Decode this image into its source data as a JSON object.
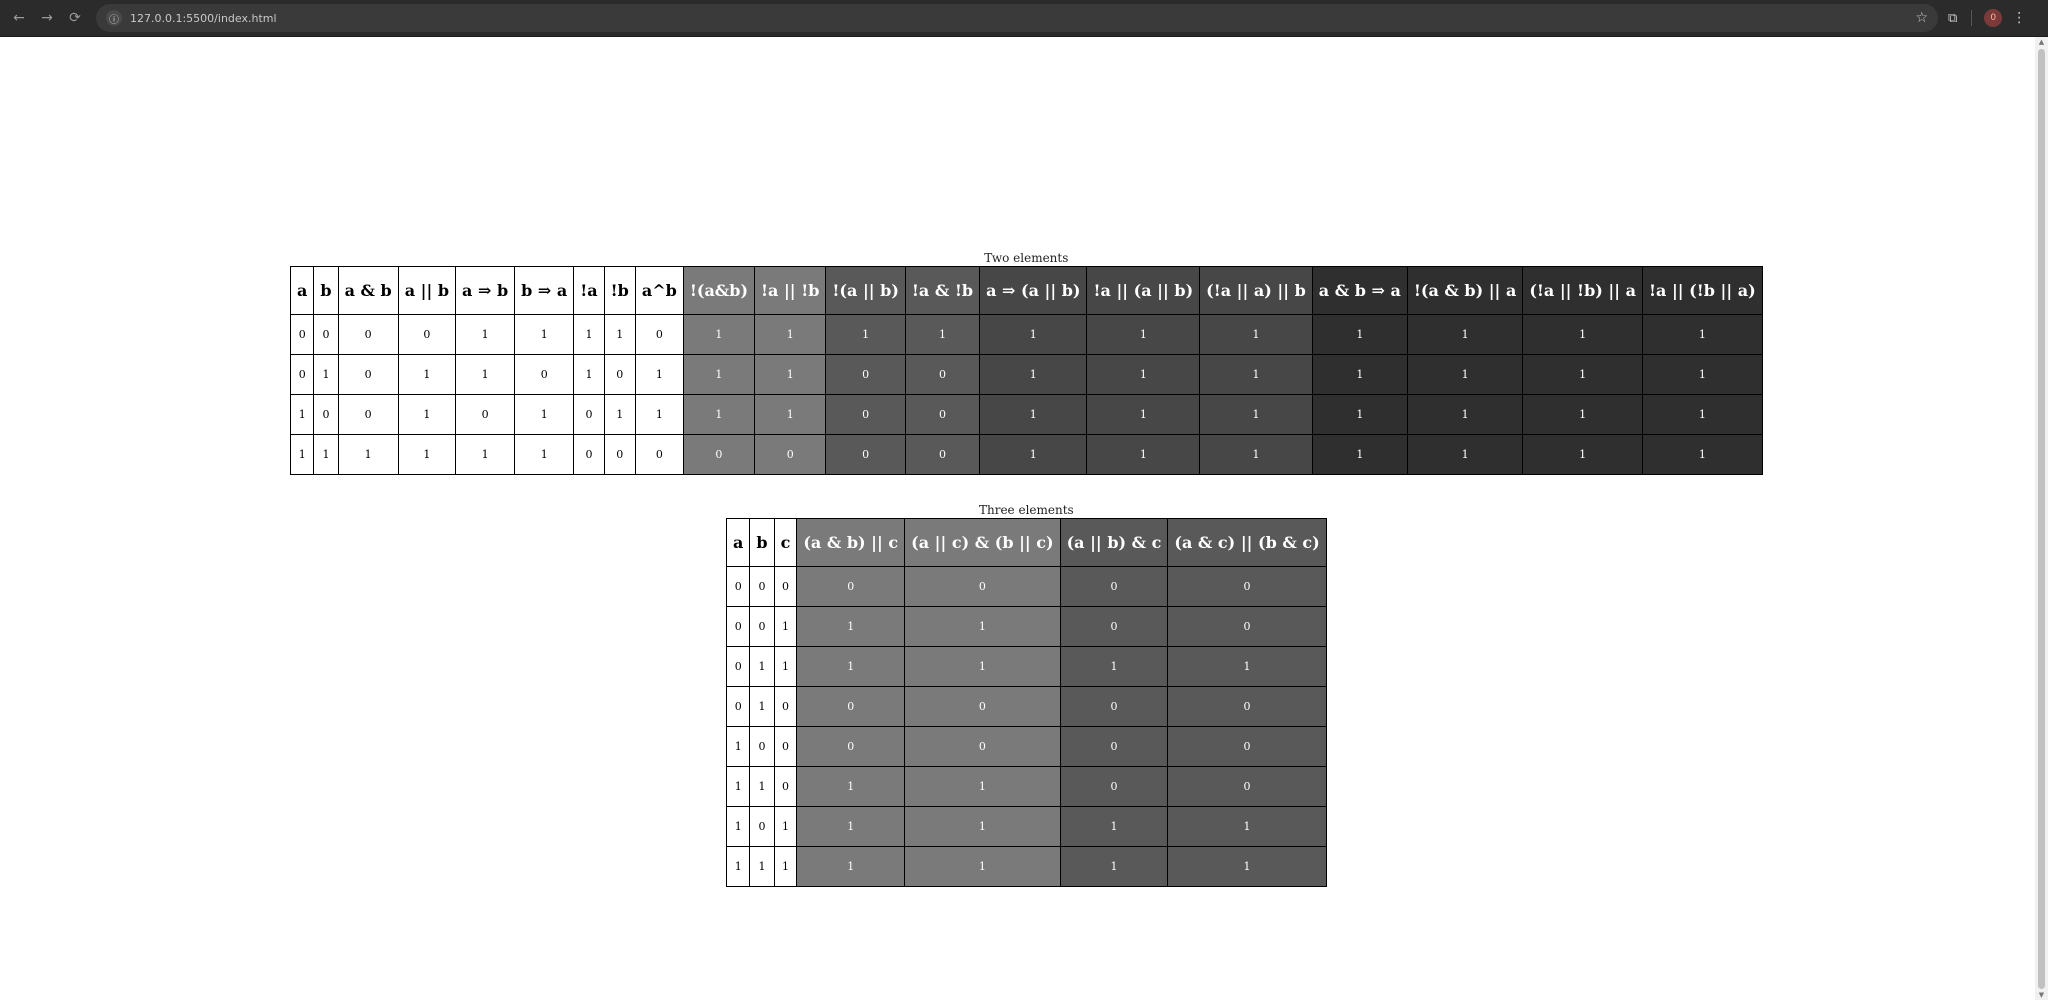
{
  "browser": {
    "url": "127.0.0.1:5500/index.html",
    "profile_initial": "0"
  },
  "tables": [
    {
      "caption": "Two elements",
      "headers": [
        {
          "label": "a",
          "shade": 0
        },
        {
          "label": "b",
          "shade": 0
        },
        {
          "label": "a & b",
          "shade": 0
        },
        {
          "label": "a || b",
          "shade": 0
        },
        {
          "label": "a ⇒ b",
          "shade": 0
        },
        {
          "label": "b ⇒ a",
          "shade": 0
        },
        {
          "label": "!a",
          "shade": 0
        },
        {
          "label": "!b",
          "shade": 0
        },
        {
          "label": "a^b",
          "shade": 0
        },
        {
          "label": "!(a&b)",
          "shade": 1
        },
        {
          "label": "!a || !b",
          "shade": 1
        },
        {
          "label": "!(a || b)",
          "shade": 2
        },
        {
          "label": "!a & !b",
          "shade": 2
        },
        {
          "label": "a ⇒ (a || b)",
          "shade": 3
        },
        {
          "label": "!a || (a || b)",
          "shade": 3
        },
        {
          "label": "(!a || a) || b",
          "shade": 3
        },
        {
          "label": "a & b ⇒ a",
          "shade": 4
        },
        {
          "label": "!(a & b) || a",
          "shade": 4
        },
        {
          "label": "(!a || !b) || a",
          "shade": 4
        },
        {
          "label": "!a || (!b || a)",
          "shade": 4
        }
      ],
      "rows": [
        [
          "0",
          "0",
          "0",
          "0",
          "1",
          "1",
          "1",
          "1",
          "0",
          "1",
          "1",
          "1",
          "1",
          "1",
          "1",
          "1",
          "1",
          "1",
          "1",
          "1"
        ],
        [
          "0",
          "1",
          "0",
          "1",
          "1",
          "0",
          "1",
          "0",
          "1",
          "1",
          "1",
          "0",
          "0",
          "1",
          "1",
          "1",
          "1",
          "1",
          "1",
          "1"
        ],
        [
          "1",
          "0",
          "0",
          "1",
          "0",
          "1",
          "0",
          "1",
          "1",
          "1",
          "1",
          "0",
          "0",
          "1",
          "1",
          "1",
          "1",
          "1",
          "1",
          "1"
        ],
        [
          "1",
          "1",
          "1",
          "1",
          "1",
          "1",
          "0",
          "0",
          "0",
          "0",
          "0",
          "0",
          "0",
          "1",
          "1",
          "1",
          "1",
          "1",
          "1",
          "1"
        ]
      ]
    },
    {
      "caption": "Three elements",
      "headers": [
        {
          "label": "a",
          "shade": 0
        },
        {
          "label": "b",
          "shade": 0
        },
        {
          "label": "c",
          "shade": 0
        },
        {
          "label": "(a & b) || c",
          "shade": 1
        },
        {
          "label": "(a || c) & (b || c)",
          "shade": 1
        },
        {
          "label": "(a || b) & c",
          "shade": 2
        },
        {
          "label": "(a & c) || (b & c)",
          "shade": 2
        }
      ],
      "rows": [
        [
          "0",
          "0",
          "0",
          "0",
          "0",
          "0",
          "0"
        ],
        [
          "0",
          "0",
          "1",
          "1",
          "1",
          "0",
          "0"
        ],
        [
          "0",
          "1",
          "1",
          "1",
          "1",
          "1",
          "1"
        ],
        [
          "0",
          "1",
          "0",
          "0",
          "0",
          "0",
          "0"
        ],
        [
          "1",
          "0",
          "0",
          "0",
          "0",
          "0",
          "0"
        ],
        [
          "1",
          "1",
          "0",
          "1",
          "1",
          "0",
          "0"
        ],
        [
          "1",
          "0",
          "1",
          "1",
          "1",
          "1",
          "1"
        ],
        [
          "1",
          "1",
          "1",
          "1",
          "1",
          "1",
          "1"
        ]
      ]
    }
  ],
  "colors": {
    "shade0": "#ffffff",
    "shade1": "#7a7a7a",
    "shade2": "#595959",
    "shade3": "#474747",
    "shade4": "#2f2f2f"
  }
}
